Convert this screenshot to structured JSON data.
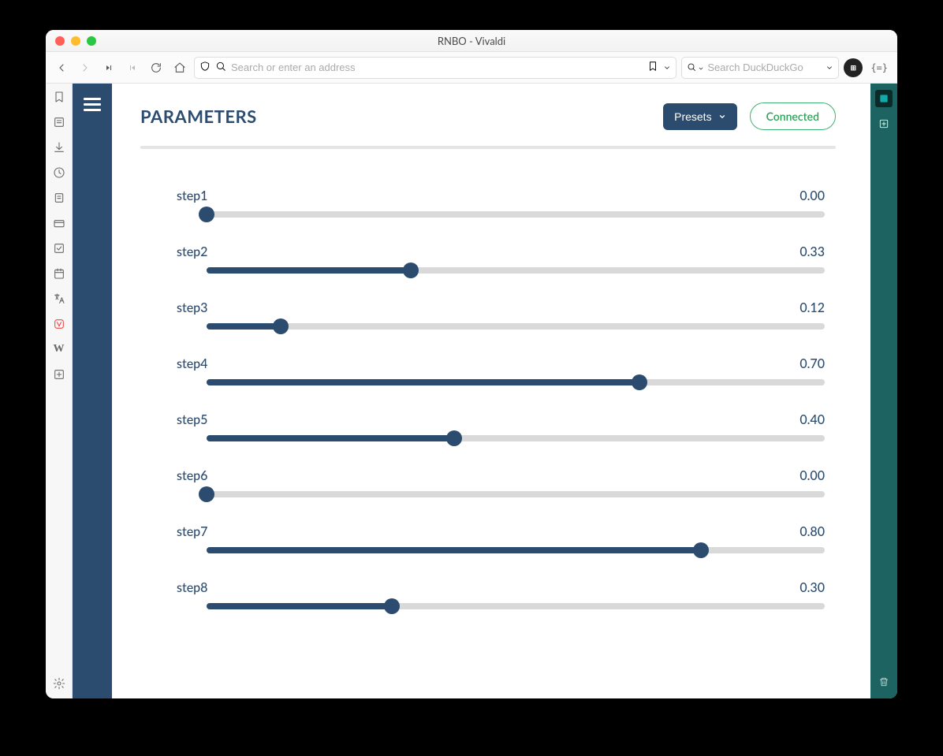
{
  "window": {
    "title": "RNBO - Vivaldi"
  },
  "toolbar": {
    "address_placeholder": "Search or enter an address",
    "search_placeholder": "Search DuckDuckGo"
  },
  "page": {
    "title": "PARAMETERS",
    "presets_label": "Presets",
    "status_label": "Connected"
  },
  "parameters": [
    {
      "name": "step1",
      "value": 0.0,
      "display": "0.00"
    },
    {
      "name": "step2",
      "value": 0.33,
      "display": "0.33"
    },
    {
      "name": "step3",
      "value": 0.12,
      "display": "0.12"
    },
    {
      "name": "step4",
      "value": 0.7,
      "display": "0.70"
    },
    {
      "name": "step5",
      "value": 0.4,
      "display": "0.40"
    },
    {
      "name": "step6",
      "value": 0.0,
      "display": "0.00"
    },
    {
      "name": "step7",
      "value": 0.8,
      "display": "0.80"
    },
    {
      "name": "step8",
      "value": 0.3,
      "display": "0.30"
    }
  ]
}
